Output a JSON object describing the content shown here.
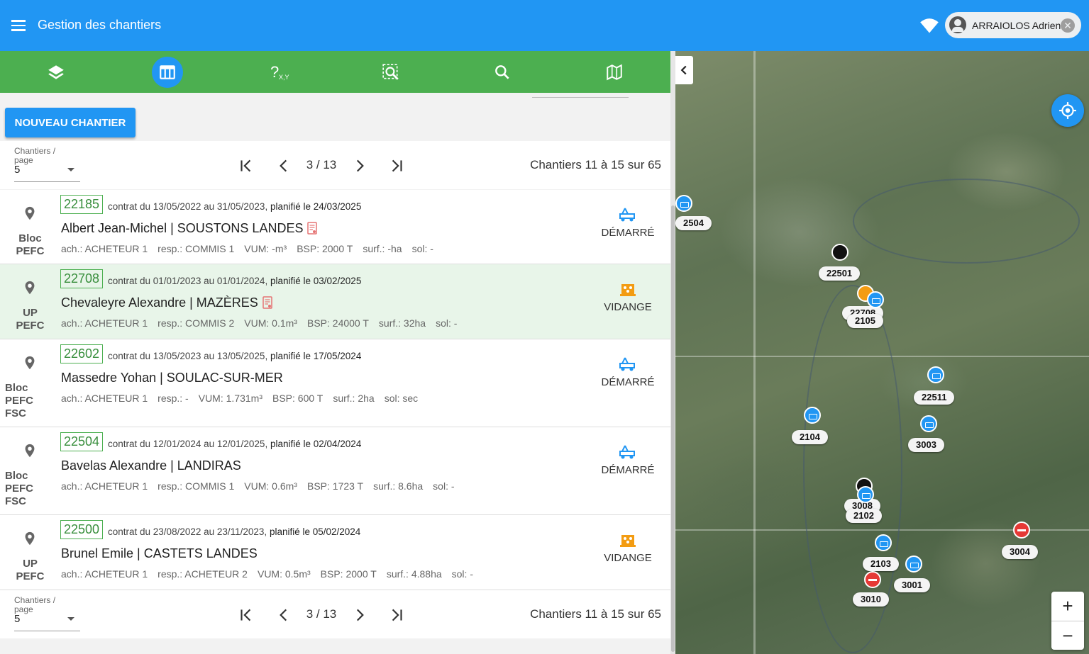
{
  "appbar": {
    "title": "Gestion des chantiers",
    "user": "ARRAIOLOS Adrien",
    "close_glyph": "✕"
  },
  "toolbar": {
    "buttons": [
      "layers-icon",
      "table-icon",
      "coordinates-query-icon",
      "zoom-area-icon",
      "search-icon",
      "map-icon"
    ],
    "active": "table-icon",
    "xy_label": "X,Y"
  },
  "new_button": "NOUVEAU CHANTIER",
  "pager": {
    "per_page_label": "Chantiers / page",
    "per_page": "5",
    "pages": "3 / 13",
    "range": "Chantiers  11 à 15 sur 65"
  },
  "rows": [
    {
      "num": "22185",
      "contract": "contrat du 13/05/2022 au 31/05/2023,",
      "planned": "planifié le 24/03/2025",
      "name": "Albert Jean-Michel  |  SOUSTONS  LANDES",
      "has_doc": true,
      "cert": [
        "Bloc",
        "PEFC"
      ],
      "meta": [
        "ach.:  ACHETEUR 1",
        "resp.:  COMMIS 1",
        "VUM:  -m³",
        "BSP:  2000 T",
        "surf.:  -ha",
        "sol:  -"
      ],
      "status": "DÉMARRÉ",
      "status_kind": "started"
    },
    {
      "num": "22708",
      "contract": "contrat du 01/01/2023 au 01/01/2024,",
      "planned": "planifié le 03/02/2025",
      "name": "Chevaleyre Alexandre  |  MAZÈRES",
      "has_doc": true,
      "cert": [
        "UP",
        "PEFC"
      ],
      "meta": [
        "ach.:  ACHETEUR 1",
        "resp.:  COMMIS 2",
        "VUM:  0.1m³",
        "BSP:  24000 T",
        "surf.:  32ha",
        "sol:  -"
      ],
      "status": "VIDANGE",
      "status_kind": "emptying"
    },
    {
      "num": "22602",
      "contract": "contrat du 13/05/2023 au 13/05/2025,",
      "planned": "planifié le 17/05/2024",
      "name": "Massedre Yohan  |  SOULAC-SUR-MER",
      "has_doc": false,
      "cert": [
        "Bloc",
        "PEFC",
        "FSC"
      ],
      "meta": [
        "ach.:  ACHETEUR 1",
        "resp.:  -",
        "VUM:  1.731m³",
        "BSP:  600 T",
        "surf.:  2ha",
        "sol:  sec"
      ],
      "status": "DÉMARRÉ",
      "status_kind": "started"
    },
    {
      "num": "22504",
      "contract": "contrat du 12/01/2024 au 12/01/2025,",
      "planned": "planifié le 02/04/2024",
      "name": "Bavelas Alexandre  |  LANDIRAS",
      "has_doc": false,
      "cert": [
        "Bloc",
        "PEFC",
        "FSC"
      ],
      "meta": [
        "ach.:  ACHETEUR 1",
        "resp.:  COMMIS 1",
        "VUM:  0.6m³",
        "BSP:  1723 T",
        "surf.:  8.6ha",
        "sol:  -"
      ],
      "status": "DÉMARRÉ",
      "status_kind": "started"
    },
    {
      "num": "22500",
      "contract": "contrat du 23/08/2022 au 23/11/2023,",
      "planned": "planifié le 05/02/2024",
      "name": "Brunel Emile  |  CASTETS  LANDES",
      "has_doc": false,
      "cert": [
        "UP",
        "PEFC"
      ],
      "meta": [
        "ach.:  ACHETEUR 1",
        "resp.:  ACHETEUR 2",
        "VUM:  0.5m³",
        "BSP:  2000 T",
        "surf.:  4.88ha",
        "sol:  -"
      ],
      "status": "VIDANGE",
      "status_kind": "emptying"
    }
  ],
  "map": {
    "zoom_in": "+",
    "zoom_out": "−",
    "markers": [
      {
        "label": "2504",
        "kind": "blue"
      },
      {
        "label": "22501",
        "kind": "black"
      },
      {
        "label": "22708",
        "kind": "orange"
      },
      {
        "label": "2105",
        "kind": "blue"
      },
      {
        "label": "22511",
        "kind": "blue"
      },
      {
        "label": "2104",
        "kind": "blue"
      },
      {
        "label": "3003",
        "kind": "blue"
      },
      {
        "label": "3008",
        "kind": "black"
      },
      {
        "label": "2102",
        "kind": "blue"
      },
      {
        "label": "3004",
        "kind": "red"
      },
      {
        "label": "2103",
        "kind": "blue"
      },
      {
        "label": "3001",
        "kind": "blue"
      },
      {
        "label": "3010",
        "kind": "red"
      }
    ]
  },
  "colors": {
    "appbar": "#2196f3",
    "toolbar": "#4caf50",
    "accent": "#2196f3",
    "started": "#2196f3",
    "emptying": "#f39c12",
    "doc": "#e57373"
  }
}
